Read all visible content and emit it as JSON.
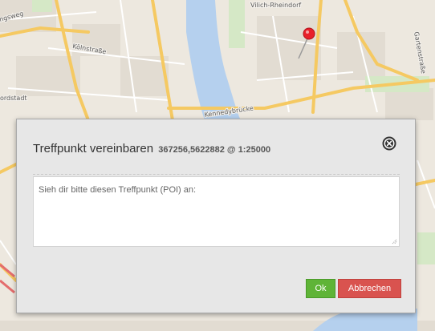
{
  "map": {
    "labels": {
      "vilich_rheindorf": "Vilich-Rheindorf",
      "koelnstrasse": "Kölnstraße",
      "kennedybruecke": "Kennedybrücke",
      "gartenstrasse": "Gartenstraße",
      "ngsweg": "ngsweg",
      "nordstadt": "ordstadt"
    },
    "marker_icon": "map-pin-icon",
    "colors": {
      "land": "#ede8df",
      "river": "#b5d0ee",
      "major_road": "#f5c962",
      "minor_road": "#ffffff",
      "green": "#d5e8c6",
      "marker": "#e8202a"
    }
  },
  "dialog": {
    "title": "Treffpunkt vereinbaren",
    "coords": "367256,5622882 @ 1:25000",
    "close_icon": "close-circle-icon",
    "message_placeholder": "Sieh dir bitte diesen Treffpunkt (POI) an:",
    "ok_label": "Ok",
    "cancel_label": "Abbrechen",
    "colors": {
      "ok": "#5fb437",
      "cancel": "#d9534f"
    }
  }
}
